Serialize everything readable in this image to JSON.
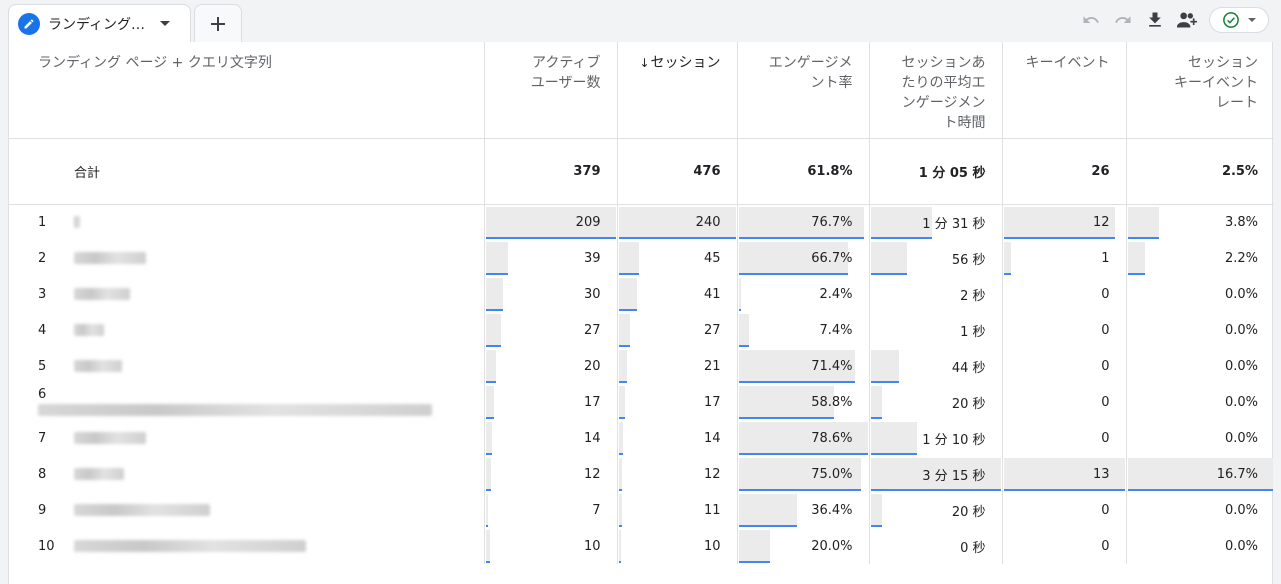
{
  "tab": {
    "label": "ランディング…",
    "icon": "pencil-icon"
  },
  "toolbar": {
    "icons": [
      "undo-icon",
      "redo-icon",
      "download-icon",
      "share-user-icon",
      "check-circle-icon"
    ]
  },
  "accent": "#1a73e8",
  "status_green": "#188038",
  "headers": {
    "dimension": "ランディング ページ + クエリ文字列",
    "active_users": [
      "アクティブ",
      "ユーザー数"
    ],
    "sessions": "セッション",
    "sessions_arrow": "↓",
    "engagement_rate": [
      "エンゲージメ",
      "ント率"
    ],
    "avg_engagement_time": [
      "セッションあ",
      "たりの平均エ",
      "ンゲージメン",
      "ト時間"
    ],
    "key_events": "キーイベント",
    "session_key_event_rate": [
      "セッション",
      "キーイベント",
      "レート"
    ]
  },
  "total": {
    "label": "合計",
    "active_users": "379",
    "sessions": "476",
    "engagement_rate": "61.8%",
    "avg_engagement_time": "1 分 05 秒",
    "key_events": "26",
    "session_key_event_rate": "2.5%"
  },
  "rows": [
    {
      "index": "1",
      "active_users": "209",
      "sessions": "240",
      "engagement_rate": "76.7%",
      "avg_engagement_time": "1 分 31 秒",
      "key_events": "12",
      "session_key_event_rate": "3.8%",
      "fill": [
        1.0,
        1.0,
        0.975,
        0.48,
        0.92,
        0.23
      ]
    },
    {
      "index": "2",
      "active_users": "39",
      "sessions": "45",
      "engagement_rate": "66.7%",
      "avg_engagement_time": "56 秒",
      "key_events": "1",
      "session_key_event_rate": "2.2%",
      "fill": [
        0.187,
        0.188,
        0.848,
        0.295,
        0.077,
        0.132
      ]
    },
    {
      "index": "3",
      "active_users": "30",
      "sessions": "41",
      "engagement_rate": "2.4%",
      "avg_engagement_time": "2 秒",
      "key_events": "0",
      "session_key_event_rate": "0.0%",
      "fill": [
        0.144,
        0.171,
        0.031,
        0.011,
        0,
        0
      ]
    },
    {
      "index": "4",
      "active_users": "27",
      "sessions": "27",
      "engagement_rate": "7.4%",
      "avg_engagement_time": "1 秒",
      "key_events": "0",
      "session_key_event_rate": "0.0%",
      "fill": [
        0.129,
        0.113,
        0.094,
        0.005,
        0,
        0
      ]
    },
    {
      "index": "5",
      "active_users": "20",
      "sessions": "21",
      "engagement_rate": "71.4%",
      "avg_engagement_time": "44 秒",
      "key_events": "0",
      "session_key_event_rate": "0.0%",
      "fill": [
        0.096,
        0.088,
        0.908,
        0.232,
        0,
        0
      ]
    },
    {
      "index": "6",
      "active_users": "17",
      "sessions": "17",
      "engagement_rate": "58.8%",
      "avg_engagement_time": "20 秒",
      "key_events": "0",
      "session_key_event_rate": "0.0%",
      "fill": [
        0.081,
        0.071,
        0.748,
        0.105,
        0,
        0
      ]
    },
    {
      "index": "7",
      "active_users": "14",
      "sessions": "14",
      "engagement_rate": "78.6%",
      "avg_engagement_time": "1 分 10 秒",
      "key_events": "0",
      "session_key_event_rate": "0.0%",
      "fill": [
        0.067,
        0.058,
        1.0,
        0.37,
        0,
        0
      ]
    },
    {
      "index": "8",
      "active_users": "12",
      "sessions": "12",
      "engagement_rate": "75.0%",
      "avg_engagement_time": "3 分 15 秒",
      "key_events": "13",
      "session_key_event_rate": "16.7%",
      "fill": [
        0.057,
        0.05,
        0.954,
        1.0,
        1.0,
        1.0
      ]
    },
    {
      "index": "9",
      "active_users": "7",
      "sessions": "11",
      "engagement_rate": "36.4%",
      "avg_engagement_time": "20 秒",
      "key_events": "0",
      "session_key_event_rate": "0.0%",
      "fill": [
        0.033,
        0.046,
        0.463,
        0.105,
        0,
        0
      ]
    },
    {
      "index": "10",
      "active_users": "10",
      "sessions": "10",
      "engagement_rate": "20.0%",
      "avg_engagement_time": "0 秒",
      "key_events": "0",
      "session_key_event_rate": "0.0%",
      "fill": [
        0.048,
        0.042,
        0.254,
        0,
        0,
        0
      ]
    }
  ]
}
